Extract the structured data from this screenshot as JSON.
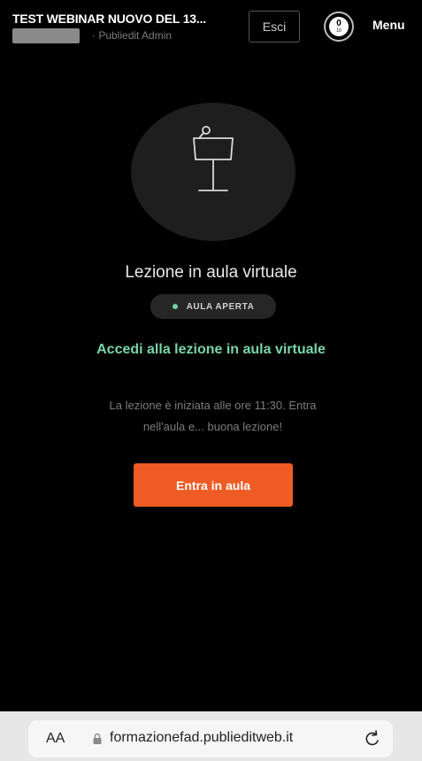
{
  "header": {
    "title": "TEST WEBINAR NUOVO DEL 13...",
    "author_role": "· Publiedit Admin",
    "exit_label": "Esci",
    "progress_completed": "0",
    "progress_total": "10",
    "menu_label": "Menu"
  },
  "hero": {
    "icon": "lectern-icon"
  },
  "lesson": {
    "title": "Lezione in aula virtuale",
    "status": "AULA APERTA",
    "access_heading": "Accedi alla lezione in aula virtuale",
    "info_line1": "La lezione è iniziata alle ore 11:30. Entra",
    "info_line2": "nell'aula e... buona lezione!",
    "enter_button": "Entra in aula"
  },
  "browser": {
    "text_size_label": "AA",
    "url": "formazionefad.publieditweb.it",
    "reload_icon": "reload-icon",
    "lock_icon": "lock-icon"
  },
  "colors": {
    "background": "#000000",
    "accent_green": "#79d4a6",
    "button_orange": "#ee5b24",
    "circle_bg": "#1e1e1e"
  }
}
